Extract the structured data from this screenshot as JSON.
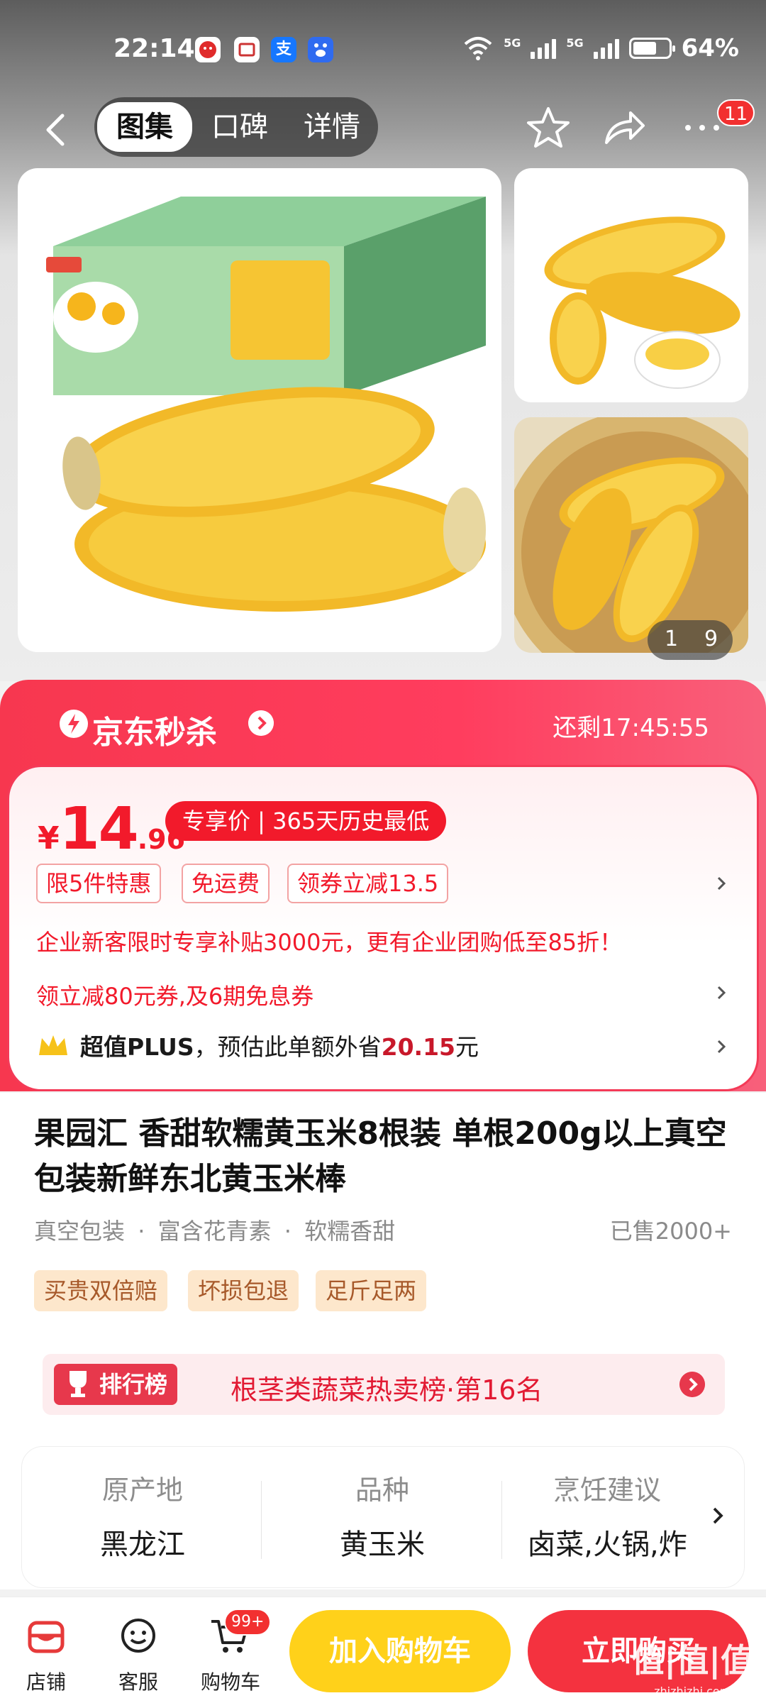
{
  "status_bar": {
    "time": "22:14",
    "net1": "5G",
    "net2": "5G",
    "battery": "64%",
    "apps": [
      "jd-app-icon",
      "news-app-icon",
      "alipay-icon",
      "baidu-icon"
    ],
    "app_alipay_label": "支"
  },
  "nav": {
    "tabs": [
      "图集",
      "口碑",
      "详情"
    ],
    "active_tab": "图集",
    "badge": "11",
    "icons": [
      "back-icon",
      "star-icon",
      "share-icon",
      "more-icon"
    ]
  },
  "gallery": {
    "counter_current": "1",
    "counter_total": "9"
  },
  "seckill": {
    "title": "京东秒杀",
    "countdown_label": "还剩",
    "countdown": "17:45:55"
  },
  "price": {
    "symbol": "¥",
    "integer": "14",
    "decimal": ".96",
    "tag": "专享价 | 365天历史最低"
  },
  "promos": [
    "限5件特惠",
    "免运费",
    "领券立减13.5"
  ],
  "offer_line": "企业新客限时专享补贴3000元，更有企业团购低至85折！",
  "coupon_line": "领立减80元券,及6期免息券",
  "plus": {
    "label": "超值PLUS",
    "text": "，预估此单额外省",
    "amount": "20.15",
    "unit": "元"
  },
  "product": {
    "title": "果园汇 香甜软糯黄玉米8根装 单根200g以上真空包装新鲜东北黄玉米棒",
    "features": [
      "真空包装",
      "富含花青素",
      "软糯香甜"
    ],
    "sold": "已售2000+",
    "service_tags": [
      "买贵双倍赔",
      "坏损包退",
      "足斤足两"
    ]
  },
  "rank": {
    "badge": "排行榜",
    "text": "根茎类蔬菜热卖榜·第16名"
  },
  "attributes": [
    {
      "key": "原产地",
      "value": "黑龙江"
    },
    {
      "key": "品种",
      "value": "黄玉米"
    },
    {
      "key": "烹饪建议",
      "value": "卤菜,火锅,炸"
    }
  ],
  "bottom_bar": {
    "shop": "店铺",
    "service": "客服",
    "cart": "购物车",
    "cart_count": "99+",
    "add_to_cart": "加入购物车",
    "buy_now": "立即购买"
  },
  "watermark": {
    "main": "值|值|值",
    "sub": "zhizhizhi.com"
  },
  "colors": {
    "accent_red": "#f21a2b",
    "seckill_red": "#f7374f",
    "add_cart_yellow": "#ffd11a",
    "buy_red": "#f4323f"
  }
}
